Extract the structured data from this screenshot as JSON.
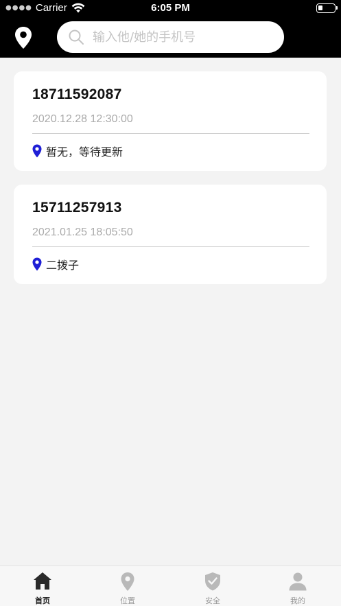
{
  "status_bar": {
    "carrier": "Carrier",
    "time": "6:05 PM"
  },
  "header": {
    "location_icon": "map-pin-icon",
    "search": {
      "placeholder": "输入他/她的手机号",
      "value": ""
    }
  },
  "records": [
    {
      "phone": "18711592087",
      "time": "2020.12.28 12:30:00",
      "location": "暂无，等待更新"
    },
    {
      "phone": "15711257913",
      "time": "2021.01.25 18:05:50",
      "location": "二拨子"
    }
  ],
  "tabs": [
    {
      "label": "首页",
      "icon": "home-icon",
      "active": true
    },
    {
      "label": "位置",
      "icon": "location-icon",
      "active": false
    },
    {
      "label": "安全",
      "icon": "shield-check-icon",
      "active": false
    },
    {
      "label": "我的",
      "icon": "user-icon",
      "active": false
    }
  ],
  "colors": {
    "header_bg": "#000000",
    "page_bg": "#f3f3f3",
    "pin_accent": "#1f1fd6",
    "tab_active": "#222222",
    "tab_inactive": "#9a9a9a"
  }
}
